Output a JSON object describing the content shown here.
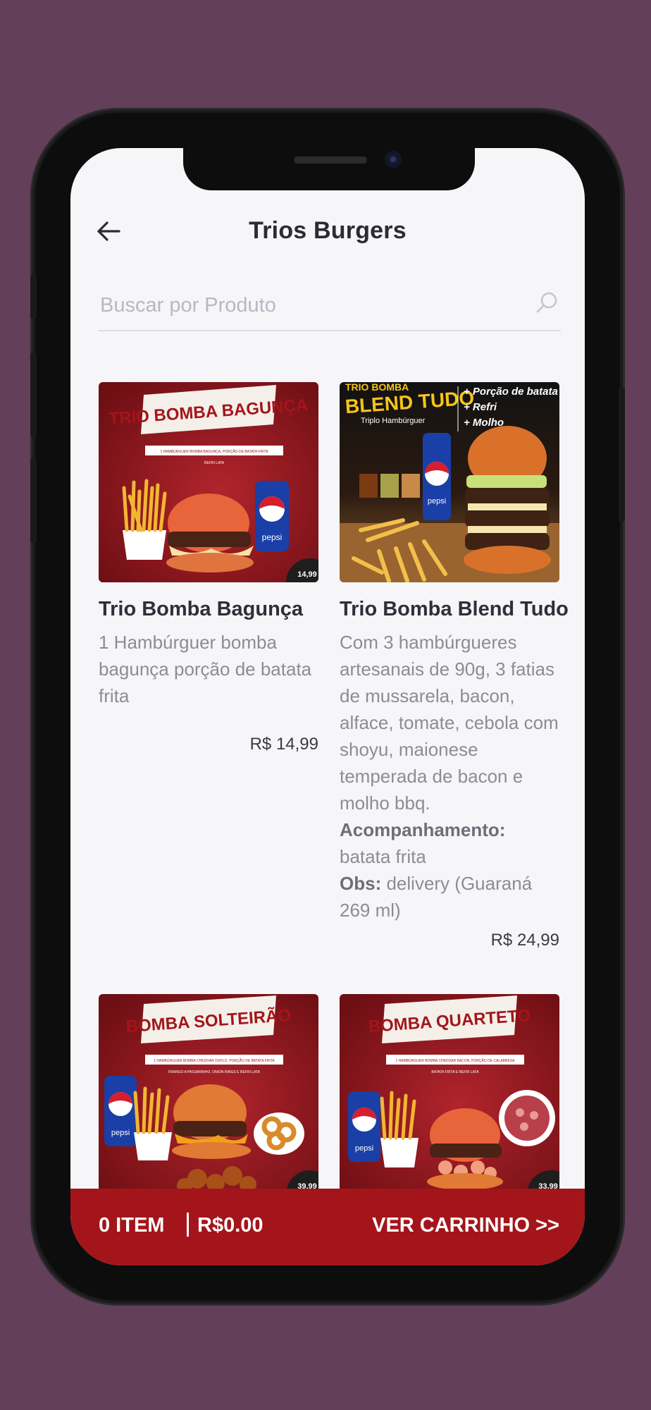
{
  "header": {
    "title": "Trios Burgers",
    "back_icon": "arrow-left-icon"
  },
  "search": {
    "placeholder": "Buscar por Produto",
    "value": "",
    "icon": "search-icon"
  },
  "products": [
    {
      "name": "Trio Bomba Bagunça",
      "description": "1 Hambúrguer bomba bagunça porção de batata frita",
      "price": "R$ 14,99",
      "image": {
        "banner": "TRIO BOMBA BAGUNÇA",
        "sub": "1 HAMBÚRGUER BOMBA BAGUNÇA, PORÇÃO DE BATATA FRITA",
        "sub2": "REFRI LATA",
        "brand": "pepsi",
        "badge": "14,99"
      }
    },
    {
      "name": "Trio Bomba Blend Tudo",
      "description": "Com 3 hambúrgueres artesanais de 90g, 3 fatias de mussarela, bacon, alface, tomate, cebola com shoyu, maionese temperada de bacon e molho bbq.",
      "extra_label": "Acompanhamento:",
      "extra_value": "batata frita",
      "obs_label": "Obs:",
      "obs_value": "delivery (Guaraná 269 ml)",
      "price": "R$ 24,99",
      "image": {
        "top": "TRIO BOMBA",
        "banner": "BLEND TUDO",
        "sub": "Triplo Hambúrguer",
        "items": [
          "+ Porção de batata",
          "+ Refri",
          "+ Molho"
        ],
        "brand": "pepsi"
      }
    },
    {
      "image": {
        "banner": "BOMBA SOLTEIRÃO",
        "sub": "1 HAMBÚRGUER BOMBA CHEDDAR DUPLO, PORÇÃO DE BATATA FRITA",
        "sub2": "FRANGO A PASSARINHO, ONION RINGS E REFRI LATA",
        "brand": "pepsi",
        "badge": "39,99"
      }
    },
    {
      "image": {
        "banner": "BOMBA QUARTETO",
        "sub": "1 HAMBÚRGUER BOMBA CHEDDAR BACON, PORÇÃO DE CALABRESA",
        "sub2": "BATATA FRITA E REFRI LATA",
        "brand": "pepsi",
        "badge": "33,99"
      }
    }
  ],
  "cart": {
    "items": "0 ITEM",
    "total": "R$0.00",
    "link": "VER CARRINHO >>"
  }
}
